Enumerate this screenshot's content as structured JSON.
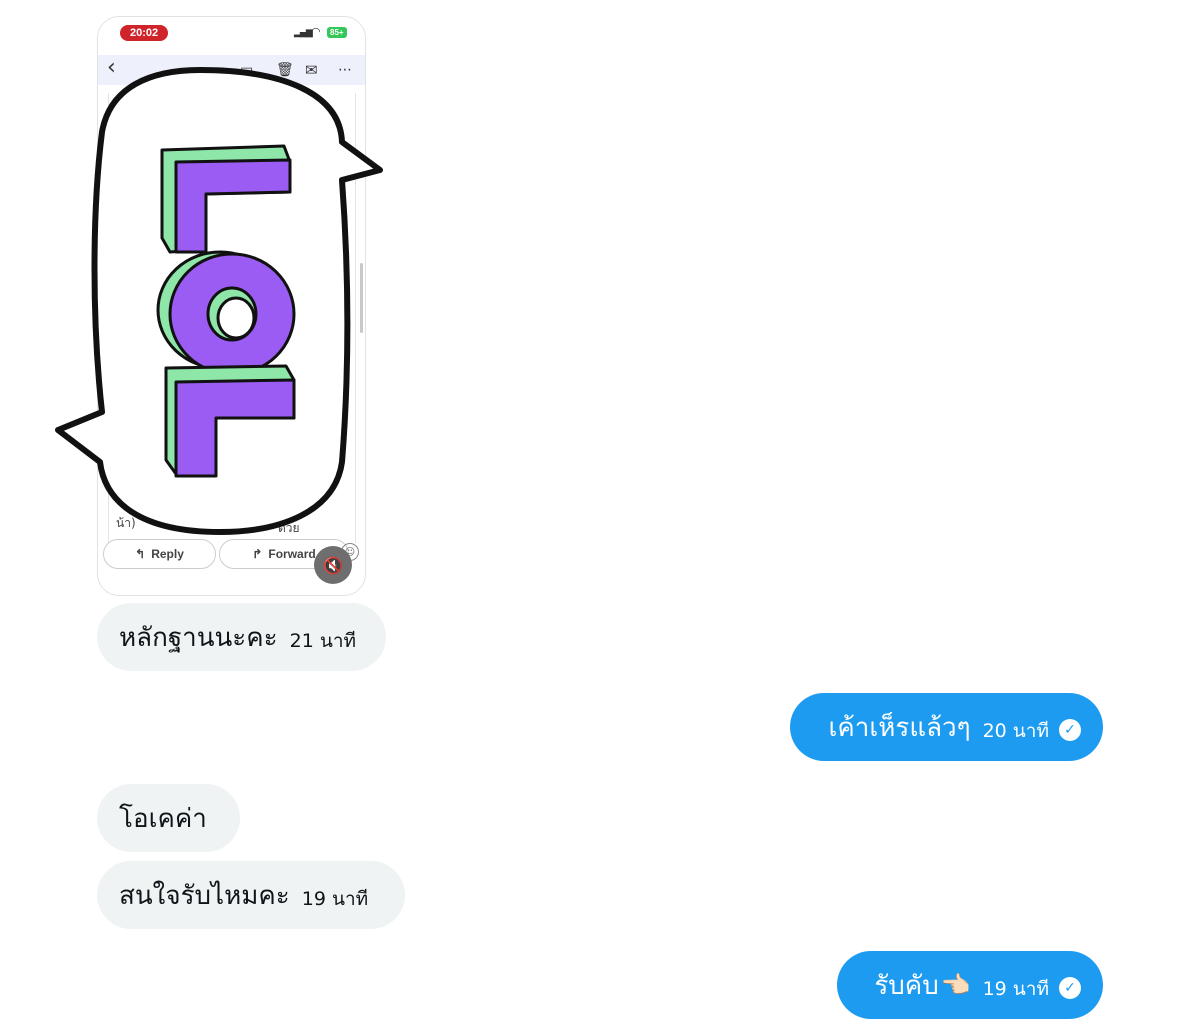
{
  "attachment": {
    "status_time": "20:02",
    "status_battery": "85+",
    "reply_label": "Reply",
    "forward_label": "Forward",
    "snippet_left": "น้า)",
    "snippet_right": "ด้วย"
  },
  "messages": [
    {
      "direction": "incoming",
      "text": "หลักฐานนะคะ",
      "time": "21 นาที"
    },
    {
      "direction": "outgoing",
      "text": "เค้าเห็รแล้วๆ",
      "time": "20 นาที"
    },
    {
      "direction": "incoming",
      "text": "โอเคค่า",
      "time": ""
    },
    {
      "direction": "incoming",
      "text": "สนใจรับไหมคะ",
      "time": "19 นาที"
    },
    {
      "direction": "outgoing",
      "text": "รับคับ",
      "emoji": "👈🏻",
      "time": "19 นาที"
    }
  ],
  "colors": {
    "outgoing_bubble": "#1d9bf0",
    "incoming_bubble": "#eff3f4",
    "sticker_green": "#8ee6a8",
    "sticker_purple": "#9a5cf2"
  }
}
